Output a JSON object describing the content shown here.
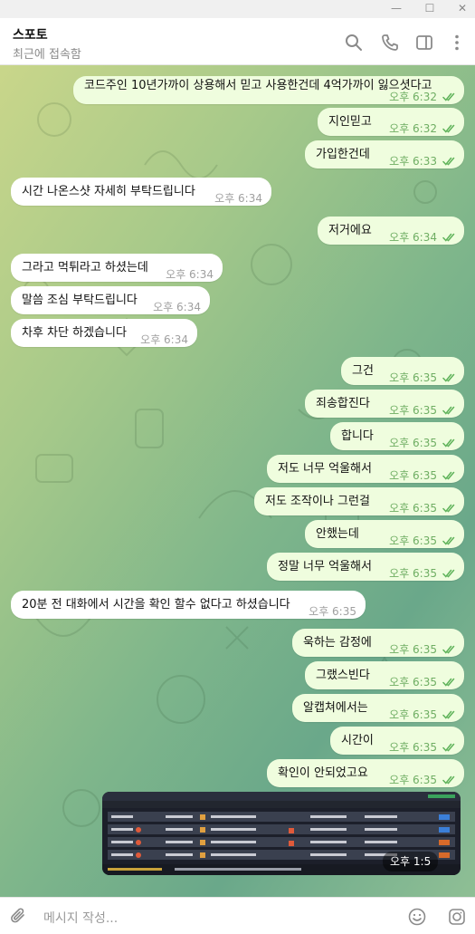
{
  "window": {
    "minimize": "—",
    "maximize": "☐",
    "close": "✕"
  },
  "header": {
    "title": "스포토",
    "status": "최근에 접속함"
  },
  "messages": [
    {
      "dir": "out",
      "text": "코드주인 10년가까이 상용해서 믿고 사용한건데 4억가까이 잃으셧다고",
      "time": "오후 6:32",
      "read": true
    },
    {
      "dir": "out",
      "text": "지인믿고",
      "time": "오후 6:32",
      "read": true
    },
    {
      "dir": "out",
      "text": "가입한건데",
      "time": "오후 6:33",
      "read": true
    },
    {
      "dir": "in",
      "text": "시간 나온스샷 자세히 부탁드립니다",
      "time": "오후 6:34"
    },
    {
      "dir": "out",
      "text": "저거에요",
      "time": "오후 6:34",
      "read": true
    },
    {
      "dir": "in",
      "text": "그라고 먹튀라고 하셨는데",
      "time": "오후 6:34"
    },
    {
      "dir": "in",
      "text": "말씀 조심 부탁드립니다",
      "time": "오후 6:34"
    },
    {
      "dir": "in",
      "text": "차후 차단 하겠습니다",
      "time": "오후 6:34"
    },
    {
      "dir": "out",
      "text": "그건",
      "time": "오후 6:35",
      "read": true
    },
    {
      "dir": "out",
      "text": "죄송합진다",
      "time": "오후 6:35",
      "read": true
    },
    {
      "dir": "out",
      "text": "합니다",
      "time": "오후 6:35",
      "read": true
    },
    {
      "dir": "out",
      "text": "저도 너무 억울해서",
      "time": "오후 6:35",
      "read": true
    },
    {
      "dir": "out",
      "text": "저도 조작이나 그런걸",
      "time": "오후 6:35",
      "read": true
    },
    {
      "dir": "out",
      "text": "안했는데",
      "time": "오후 6:35",
      "read": true
    },
    {
      "dir": "out",
      "text": "정말 너무 억울해서",
      "time": "오후 6:35",
      "read": true
    },
    {
      "dir": "in",
      "text": "20분 전 대화에서 시간을 확인 할수 없다고 하셨습니다",
      "time": "오후 6:35"
    },
    {
      "dir": "out",
      "text": "욱하는 감정에",
      "time": "오후 6:35",
      "read": true
    },
    {
      "dir": "out",
      "text": "그랬스빈다",
      "time": "오후 6:35",
      "read": true
    },
    {
      "dir": "out",
      "text": "알캡쳐에서는",
      "time": "오후 6:35",
      "read": true
    },
    {
      "dir": "out",
      "text": "시간이",
      "time": "오후 6:35",
      "read": true
    },
    {
      "dir": "out",
      "text": "확인이 안되었고요",
      "time": "오후 6:35",
      "read": true
    }
  ],
  "image_message": {
    "time": "오후 1:5"
  },
  "composer": {
    "placeholder": "메시지 작성..."
  },
  "colors": {
    "outgoing_bubble": "#effdde",
    "incoming_bubble": "#ffffff",
    "read_tick": "#5fb35a"
  }
}
